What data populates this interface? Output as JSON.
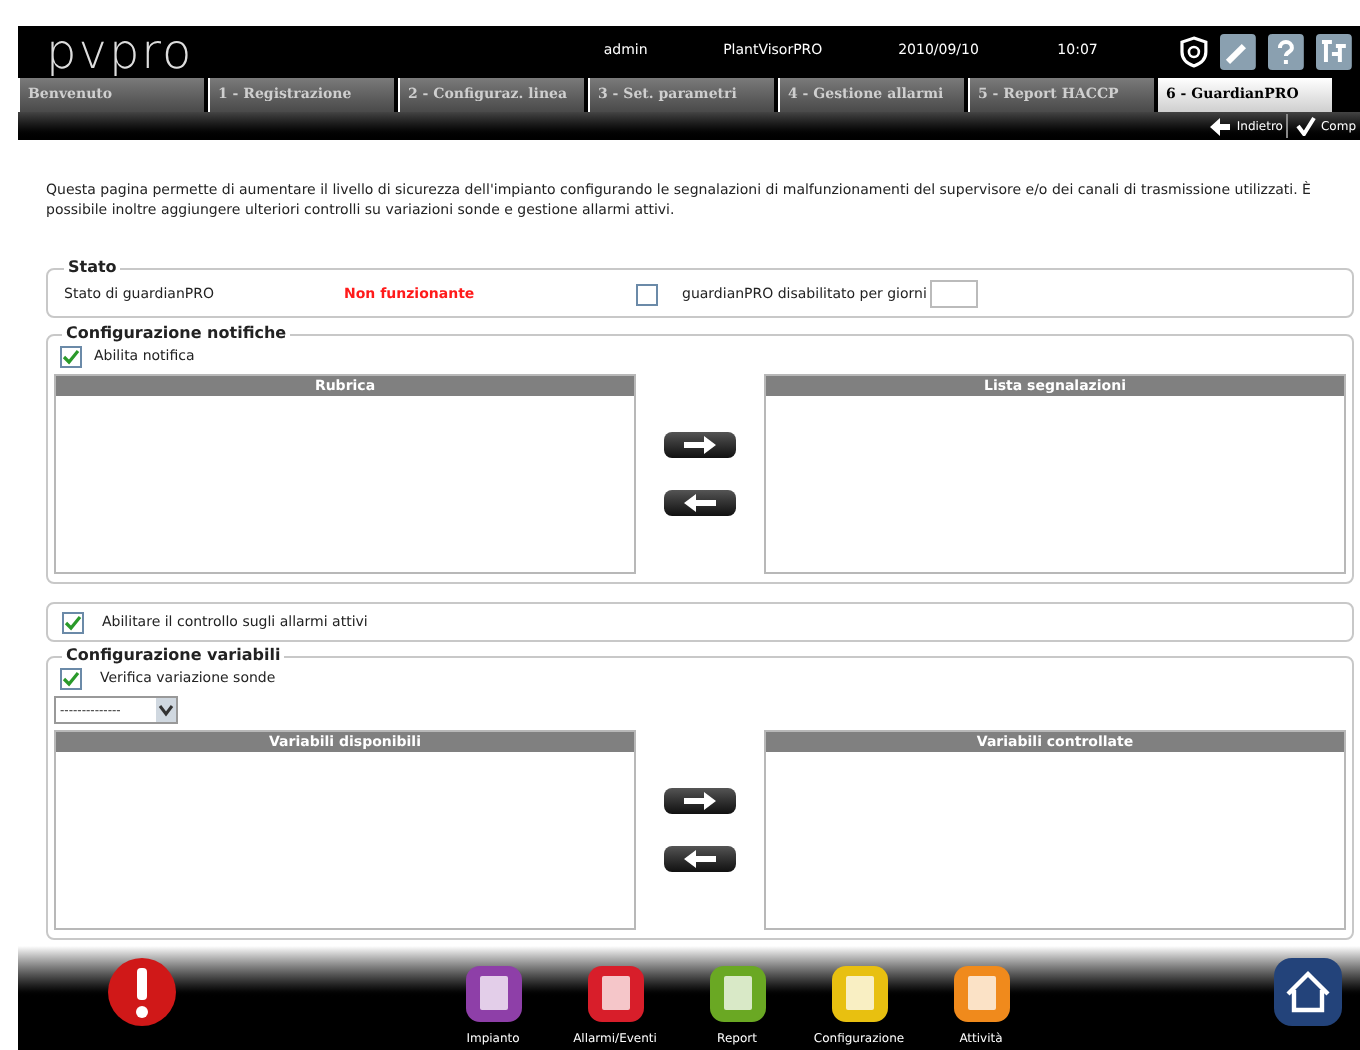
{
  "header": {
    "logo": "pvpro",
    "user": "admin",
    "app": "PlantVisorPRO",
    "date": "2010/09/10",
    "time": "10:07"
  },
  "tabs": [
    {
      "label": "Benvenuto",
      "selected": false
    },
    {
      "label": "1 - Registrazione",
      "selected": false
    },
    {
      "label": "2 - Configuraz. linea",
      "selected": false
    },
    {
      "label": "3 - Set. parametri",
      "selected": false
    },
    {
      "label": "4 - Gestione allarmi",
      "selected": false
    },
    {
      "label": "5 - Report HACCP",
      "selected": false
    },
    {
      "label": "6 - GuardianPRO",
      "selected": true
    }
  ],
  "actions": [
    {
      "label": "Indietro",
      "kind": "back"
    },
    {
      "label": "Comp",
      "kind": "confirm"
    }
  ],
  "intro": "Questa pagina permette di aumentare il livello di sicurezza dell'impianto configurando le segnalazioni di malfunzionamenti del supervisore e/o dei canali di trasmissione utilizzati. È possibile inoltre aggiungere ulteriori controlli su variazioni sonde e gestione allarmi attivi.",
  "stato": {
    "title": "Stato",
    "label": "Stato di guardianPRO",
    "status": "Non funzionante",
    "disable": {
      "label": "guardianPRO disabilitato per giorni",
      "checked": false
    }
  },
  "notifiche": {
    "title": "Configurazione notifiche",
    "enable": {
      "label": "Abilita notifica",
      "checked": true
    },
    "left_list": {
      "title": "Rubrica"
    },
    "right_list": {
      "title": "Lista segnalazioni"
    }
  },
  "alarm_check": {
    "label": "Abilitare il controllo sugli allarmi attivi",
    "checked": true
  },
  "variabili": {
    "title": "Configurazione variabili",
    "verify": {
      "label": "Verifica variazione sonde",
      "checked": true
    },
    "select": {
      "value": "--------------"
    },
    "left_list": {
      "title": "Variabili disponibili"
    },
    "right_list": {
      "title": "Variabili controllate"
    }
  },
  "dock": [
    {
      "label": "Impianto",
      "color": "#8e3fa8"
    },
    {
      "label": "Allarmi/Eventi",
      "color": "#d81e2a"
    },
    {
      "label": "Report",
      "color": "#6aa823"
    },
    {
      "label": "Configurazione",
      "color": "#e8c010"
    },
    {
      "label": "Attività",
      "color": "#f08a1c"
    }
  ]
}
